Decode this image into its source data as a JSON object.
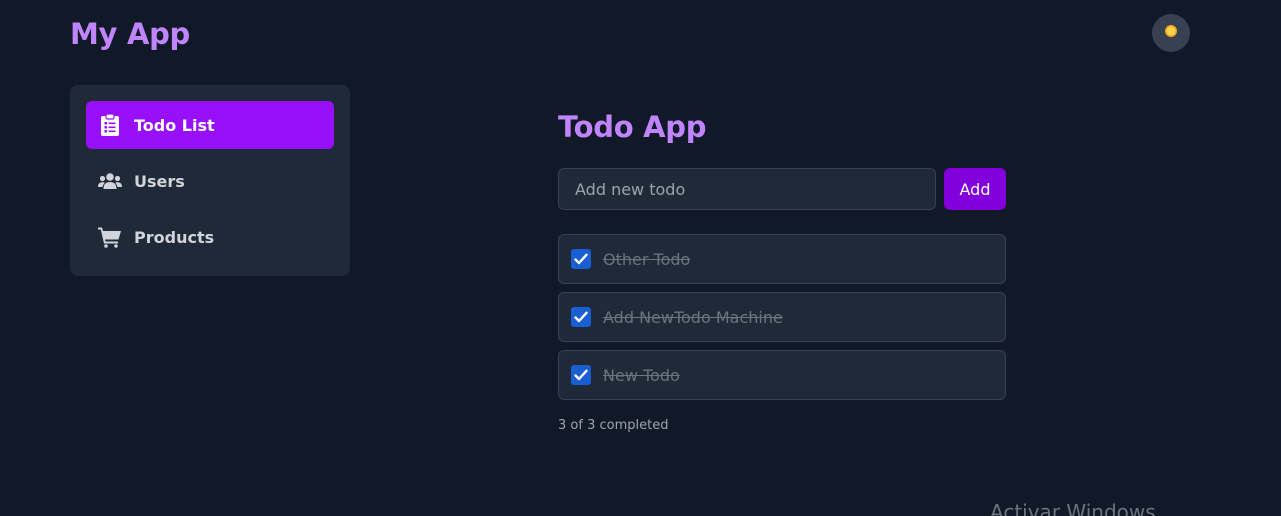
{
  "header": {
    "app_title": "My App",
    "theme_toggle_icon": "sun-icon"
  },
  "sidebar": {
    "items": [
      {
        "label": "Todo List",
        "icon": "clipboard-list-icon",
        "active": true
      },
      {
        "label": "Users",
        "icon": "users-icon",
        "active": false
      },
      {
        "label": "Products",
        "icon": "shopping-cart-icon",
        "active": false
      }
    ]
  },
  "todo": {
    "title": "Todo App",
    "input_placeholder": "Add new todo",
    "input_value": "",
    "add_label": "Add",
    "items": [
      {
        "text": "Other Todo",
        "completed": true
      },
      {
        "text": "Add NewTodo Machine",
        "completed": true
      },
      {
        "text": "New Todo",
        "completed": true
      }
    ],
    "summary": "3 of 3 completed"
  },
  "overlay": {
    "watermark": "Activar Windows"
  },
  "colors": {
    "background": "#111827",
    "panel": "#1f2937",
    "accent": "#9810fa",
    "title": "#c084fc",
    "checkbox": "#1a5fd1"
  }
}
